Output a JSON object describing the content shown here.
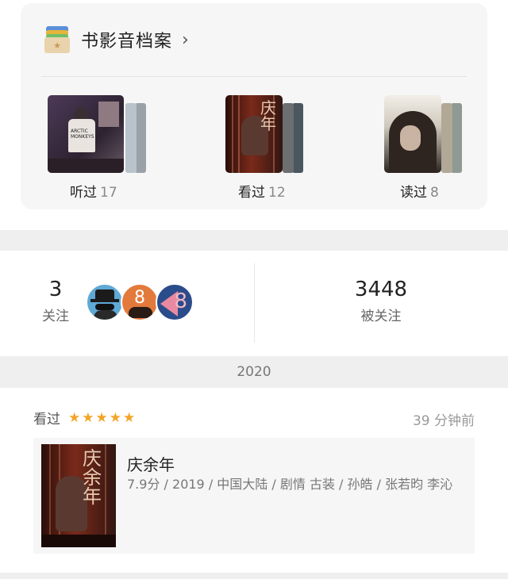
{
  "archive": {
    "title": "书影音档案",
    "groups": [
      {
        "label": "听过",
        "count": "17"
      },
      {
        "label": "看过",
        "count": "12"
      },
      {
        "label": "读过",
        "count": "8"
      }
    ]
  },
  "follow": {
    "following_count": "3",
    "following_label": "关注",
    "followers_count": "3448",
    "followers_label": "被关注"
  },
  "timeline": {
    "year": "2020",
    "entries": [
      {
        "action": "看过",
        "rating_stars": 5,
        "time": "39 分钟前",
        "title": "庆余年",
        "meta": "7.9分 / 2019 / 中国大陆 / 剧情 古装 / 孙皓 / 张若昀 李沁"
      }
    ]
  },
  "colors": {
    "star": "#f2a526",
    "card_bg": "#f6f6f6",
    "band_bg": "#efefef"
  }
}
